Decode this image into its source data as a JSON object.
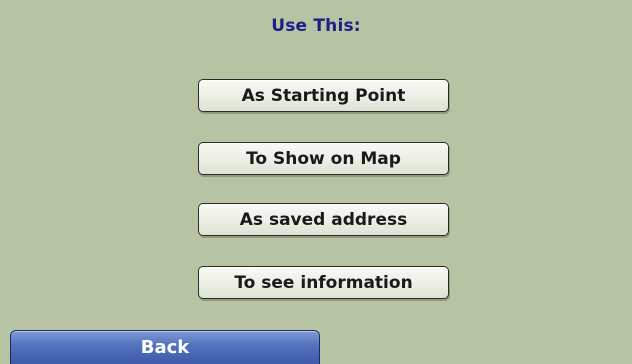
{
  "header": {
    "title": "Use This:"
  },
  "options": [
    {
      "label": "As Starting Point"
    },
    {
      "label": "To Show on Map"
    },
    {
      "label": "As saved address"
    },
    {
      "label": "To see information"
    }
  ],
  "footer": {
    "back_label": "Back"
  },
  "colors": {
    "background": "#b6c4a3",
    "title": "#1b1f86",
    "button_face": "#eef1e8",
    "back_button": "#4d6bb8"
  }
}
